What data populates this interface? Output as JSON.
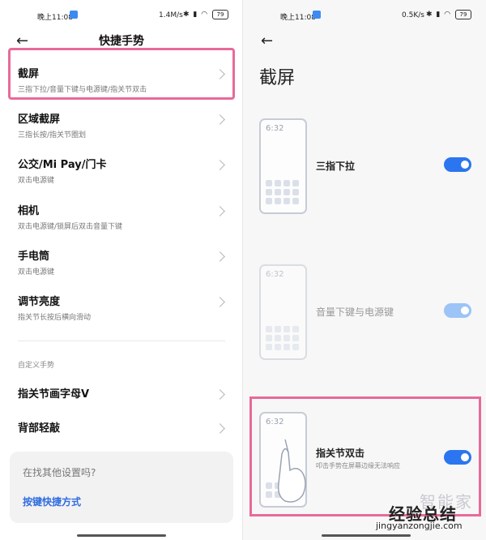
{
  "left": {
    "status": {
      "time": "晚上11:08",
      "rate": "1.4M/s",
      "battery": "79"
    },
    "title": "快捷手势",
    "items": [
      {
        "title": "截屏",
        "sub": "三指下拉/音量下键与电源键/指关节双击"
      },
      {
        "title": "区域截屏",
        "sub": "三指长按/指关节圈划"
      },
      {
        "title": "公交/Mi Pay/门卡",
        "sub": "双击电源键"
      },
      {
        "title": "相机",
        "sub": "双击电源键/锁屏后双击音量下键"
      },
      {
        "title": "手电筒",
        "sub": "双击电源键"
      },
      {
        "title": "调节亮度",
        "sub": "指关节长按后横向滑动"
      }
    ],
    "section": "自定义手势",
    "custom_items": [
      {
        "title": "指关节画字母V"
      },
      {
        "title": "背部轻敲"
      }
    ],
    "search_card": {
      "question": "在找其他设置吗?",
      "link": "按键快捷方式"
    }
  },
  "right": {
    "status": {
      "time": "晚上11:08",
      "rate": "0.5K/s",
      "battery": "79"
    },
    "title": "截屏",
    "phone_time": "6:32",
    "options": [
      {
        "label": "三指下拉",
        "enabled": true
      },
      {
        "label": "音量下键与电源键",
        "enabled": false
      },
      {
        "label": "指关节双击",
        "sub": "叩击手势在屏幕边缘无法响应",
        "enabled": true
      }
    ]
  },
  "watermark": {
    "top": "智能家",
    "brand": "经验总结",
    "url": "jingyanzongjie.com"
  },
  "colors": {
    "accent": "#2b76f0",
    "highlight": "#e86a9a"
  }
}
